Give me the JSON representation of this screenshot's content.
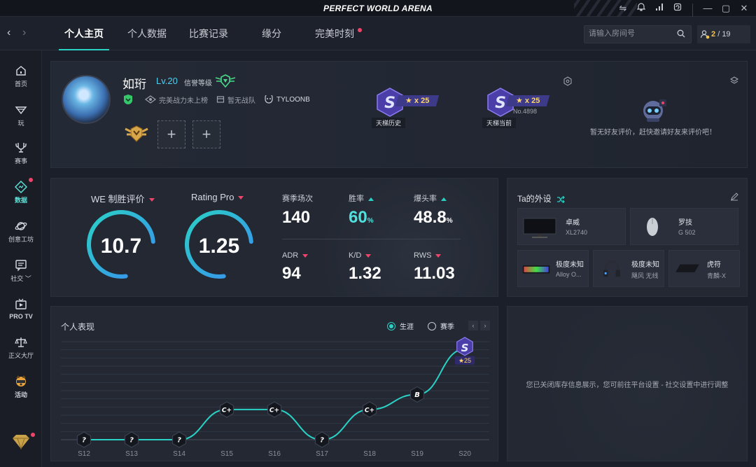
{
  "window": {
    "title": "PERFECT WORLD ARENA",
    "icons": [
      "swap-icon",
      "bell-icon",
      "signal-icon",
      "refresh-icon",
      "minimize-icon",
      "maximize-icon",
      "close-icon"
    ]
  },
  "nav": {
    "tabs": [
      {
        "label": "个人主页",
        "active": true
      },
      {
        "label": "个人数据"
      },
      {
        "label": "比赛记录"
      },
      {
        "label": "缘分"
      },
      {
        "label": "完美时刻",
        "dot": true
      }
    ],
    "search_placeholder": "请输入房间号",
    "friends_online": "2",
    "friends_sep": "/",
    "friends_total": "19"
  },
  "sidebar": {
    "items": [
      {
        "label": "首页",
        "icon": "home-icon"
      },
      {
        "label": "玩",
        "icon": "play-icon"
      },
      {
        "label": "赛事",
        "icon": "trophy-icon"
      },
      {
        "label": "数据",
        "icon": "data-icon",
        "active": true,
        "dot": true
      },
      {
        "label": "创意工坊",
        "icon": "planet-icon"
      },
      {
        "label": "社交",
        "icon": "chat-icon",
        "caret": "﹀"
      },
      {
        "label": "PRO TV",
        "icon": "tv-icon"
      },
      {
        "label": "正义大厅",
        "icon": "scales-icon"
      },
      {
        "label": "活动",
        "icon": "dog-icon"
      }
    ]
  },
  "profile": {
    "name": "如珩",
    "level": "Lv.20",
    "credit_label": "信誉等级",
    "power_text": "完美战力未上榜",
    "team_text": "暂无战队",
    "clan_text": "TYLOONB",
    "ladder_history": {
      "label": "天梯历史",
      "stars": "★ x 25"
    },
    "ladder_current": {
      "label": "天梯当前",
      "stars": "★ x 25",
      "number": "No.4898"
    },
    "friend_eval": "暂无好友评价，赶快邀请好友来评价吧！"
  },
  "stats": {
    "we_title": "WE 制胜评价",
    "we_value": "10.7",
    "we_fraction": 0.76,
    "rating_title": "Rating Pro",
    "rating_value": "1.25",
    "rating_fraction": 0.76,
    "items": [
      {
        "label": "赛季场次",
        "value": "140"
      },
      {
        "label": "胜率",
        "value": "60",
        "unit": "%",
        "trend": "up",
        "highlight": true
      },
      {
        "label": "爆头率",
        "value": "48.8",
        "unit": "%",
        "trend": "up"
      },
      {
        "label": "ADR",
        "value": "94",
        "trend": "down"
      },
      {
        "label": "K/D",
        "value": "1.32",
        "trend": "down"
      },
      {
        "label": "RWS",
        "value": "11.03",
        "trend": "down"
      }
    ]
  },
  "gear": {
    "title": "Ta的外设",
    "items": [
      {
        "brand": "卓威",
        "model": "XL2740",
        "kind": "monitor"
      },
      {
        "brand": "罗技",
        "model": "G 502",
        "kind": "mouse"
      },
      {
        "brand": "极度未知",
        "model": "Alloy O...",
        "kind": "keyboard"
      },
      {
        "brand": "极度未知",
        "model": "飓风 无线",
        "kind": "headset"
      },
      {
        "brand": "虎符",
        "model": "青麟-X",
        "kind": "mousepad"
      }
    ]
  },
  "performance": {
    "title": "个人表现",
    "mode_career": "生涯",
    "mode_season": "赛季",
    "prev": "‹",
    "next": "›"
  },
  "inventory": {
    "message": "您已关闭库存信息展示，您可前往平台设置 - 社交设置中进行调整"
  },
  "chart_data": {
    "type": "line",
    "categories": [
      "S12",
      "S13",
      "S14",
      "S15",
      "S16",
      "S17",
      "S18",
      "S19",
      "S20"
    ],
    "series": [
      {
        "values": [
          0,
          0,
          0,
          2,
          2,
          0,
          2,
          3,
          6
        ]
      }
    ],
    "point_labels": [
      "?",
      "?",
      "?",
      "C+",
      "C+",
      "?",
      "C+",
      "B",
      "S"
    ],
    "last_point_badge": "★25",
    "line_color": "#2ad1c5",
    "ylim": [
      0,
      6.5
    ]
  }
}
